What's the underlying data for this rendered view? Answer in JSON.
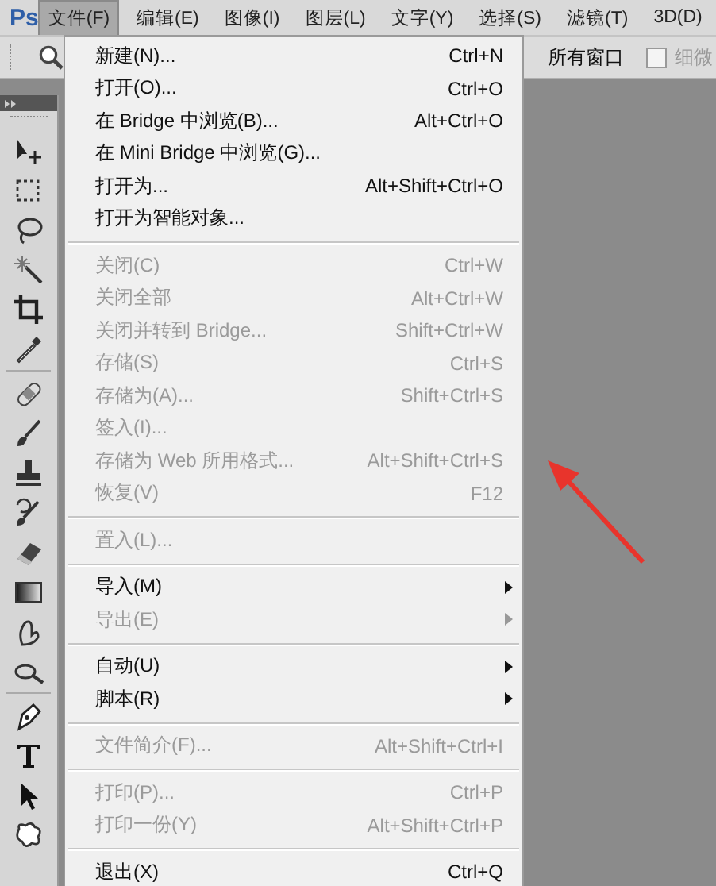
{
  "menubar": {
    "logo": "Ps",
    "menus": [
      {
        "label": "文件(F)",
        "selected": true
      },
      {
        "label": "编辑(E)",
        "selected": false
      },
      {
        "label": "图像(I)",
        "selected": false
      },
      {
        "label": "图层(L)",
        "selected": false
      },
      {
        "label": "文字(Y)",
        "selected": false
      },
      {
        "label": "选择(S)",
        "selected": false
      },
      {
        "label": "滤镜(T)",
        "selected": false
      },
      {
        "label": "3D(D)",
        "selected": false
      }
    ]
  },
  "options_bar": {
    "text": "所有窗口",
    "checkbox": {
      "label": "细微",
      "checked": false
    }
  },
  "file_menu": {
    "groups": [
      {
        "items": [
          {
            "label": "新建(N)...",
            "shortcut": "Ctrl+N",
            "disabled": false,
            "submenu": false
          },
          {
            "label": "打开(O)...",
            "shortcut": "Ctrl+O",
            "disabled": false,
            "submenu": false
          },
          {
            "label": "在 Bridge 中浏览(B)...",
            "shortcut": "Alt+Ctrl+O",
            "disabled": false,
            "submenu": false
          },
          {
            "label": "在 Mini Bridge 中浏览(G)...",
            "disabled": false,
            "submenu": false
          },
          {
            "label": "打开为...",
            "shortcut": "Alt+Shift+Ctrl+O",
            "disabled": false,
            "submenu": false
          },
          {
            "label": "打开为智能对象...",
            "disabled": false,
            "submenu": false
          }
        ]
      },
      {
        "items": [
          {
            "label": "关闭(C)",
            "shortcut": "Ctrl+W",
            "disabled": true,
            "submenu": false
          },
          {
            "label": "关闭全部",
            "shortcut": "Alt+Ctrl+W",
            "disabled": true,
            "submenu": false
          },
          {
            "label": "关闭并转到 Bridge...",
            "shortcut": "Shift+Ctrl+W",
            "disabled": true,
            "submenu": false
          },
          {
            "label": "存储(S)",
            "shortcut": "Ctrl+S",
            "disabled": true,
            "submenu": false
          },
          {
            "label": "存储为(A)...",
            "shortcut": "Shift+Ctrl+S",
            "disabled": true,
            "submenu": false
          },
          {
            "label": "签入(I)...",
            "disabled": true,
            "submenu": false
          },
          {
            "label": "存储为 Web 所用格式...",
            "shortcut": "Alt+Shift+Ctrl+S",
            "disabled": true,
            "submenu": false
          },
          {
            "label": "恢复(V)",
            "shortcut": "F12",
            "disabled": true,
            "submenu": false
          }
        ]
      },
      {
        "items": [
          {
            "label": "置入(L)...",
            "disabled": true,
            "submenu": false
          }
        ]
      },
      {
        "items": [
          {
            "label": "导入(M)",
            "disabled": false,
            "submenu": true
          },
          {
            "label": "导出(E)",
            "disabled": true,
            "submenu": true
          }
        ]
      },
      {
        "items": [
          {
            "label": "自动(U)",
            "disabled": false,
            "submenu": true
          },
          {
            "label": "脚本(R)",
            "disabled": false,
            "submenu": true
          }
        ]
      },
      {
        "items": [
          {
            "label": "文件简介(F)...",
            "shortcut": "Alt+Shift+Ctrl+I",
            "disabled": true,
            "submenu": false
          }
        ]
      },
      {
        "items": [
          {
            "label": "打印(P)...",
            "shortcut": "Ctrl+P",
            "disabled": true,
            "submenu": false
          },
          {
            "label": "打印一份(Y)",
            "shortcut": "Alt+Shift+Ctrl+P",
            "disabled": true,
            "submenu": false
          }
        ]
      },
      {
        "items": [
          {
            "label": "退出(X)",
            "shortcut": "Ctrl+Q",
            "disabled": false,
            "submenu": false
          }
        ]
      }
    ]
  }
}
